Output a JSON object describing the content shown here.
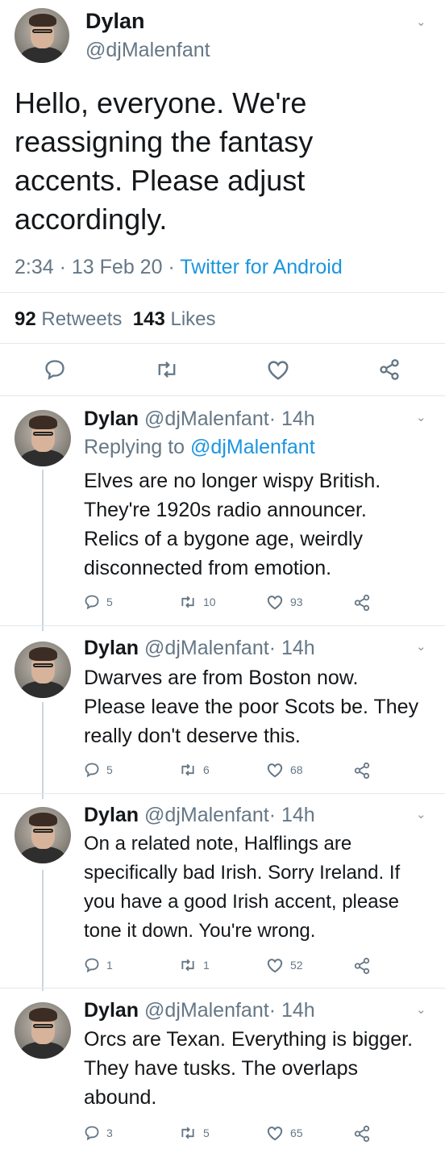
{
  "main_tweet": {
    "name": "Dylan",
    "handle": "@djMalenfant",
    "text": "Hello, everyone. We're reassigning the fantasy accents. Please adjust accordingly.",
    "time": "2:34",
    "date": "13 Feb 20",
    "source": "Twitter for Android",
    "retweets_count": "92",
    "retweets_label": "Retweets",
    "likes_count": "143",
    "likes_label": "Likes"
  },
  "replies": [
    {
      "name": "Dylan",
      "handle": "@djMalenfant",
      "age": "14h",
      "replying_prefix": "Replying to",
      "replying_handle": "@djMalenfant",
      "text": "Elves are no longer wispy British. They're 1920s radio announcer. Relics of a bygone age, weirdly disconnected from emotion.",
      "replies": "5",
      "retweets": "10",
      "likes": "93"
    },
    {
      "name": "Dylan",
      "handle": "@djMalenfant",
      "age": "14h",
      "text": "Dwarves are from Boston now. Please leave the poor Scots be. They really don't deserve this.",
      "replies": "5",
      "retweets": "6",
      "likes": "68"
    },
    {
      "name": "Dylan",
      "handle": "@djMalenfant",
      "age": "14h",
      "text": "On a related note, Halflings are specifically bad Irish. Sorry Ireland. If you have a good Irish accent, please tone it down. You're wrong.",
      "replies": "1",
      "retweets": "1",
      "likes": "52"
    },
    {
      "name": "Dylan",
      "handle": "@djMalenfant",
      "age": "14h",
      "text": "Orcs are Texan. Everything is bigger. They have tusks. The overlaps abound.",
      "replies": "3",
      "retweets": "5",
      "likes": "65"
    }
  ],
  "separator": "·",
  "colors": {
    "link": "#1b95e0",
    "muted": "#657786",
    "text": "#14171a",
    "divider": "#e1e8ed"
  }
}
